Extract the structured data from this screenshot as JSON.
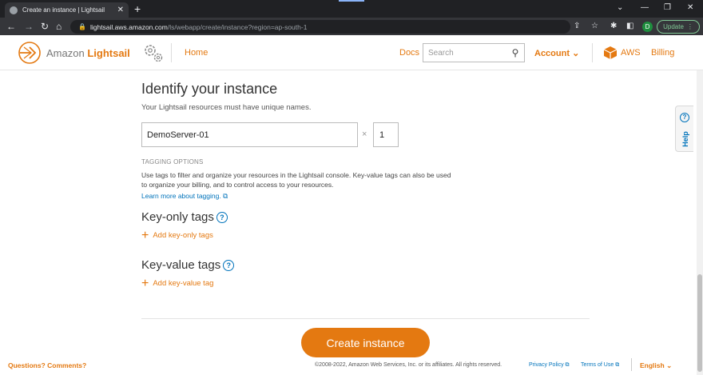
{
  "browser": {
    "tab_title": "Create an instance | Lightsail",
    "tab_close": "✕",
    "new_tab": "+",
    "url_host": "lightsail.aws.amazon.com",
    "url_path": "/ls/webapp/create/instance?region=ap-south-1",
    "profile_initial": "D",
    "update_label": "Update"
  },
  "header": {
    "brand_prefix": "Amazon",
    "brand_name": "Lightsail",
    "home": "Home",
    "docs": "Docs",
    "search_placeholder": "Search",
    "account": "Account",
    "aws": "AWS",
    "billing": "Billing",
    "accent_color": "#e47911"
  },
  "main": {
    "title": "Identify your instance",
    "subtitle": "Your Lightsail resources must have unique names.",
    "instance_name": "DemoServer-01",
    "multiplier": "×",
    "instance_count": "1",
    "tagging_heading": "TAGGING OPTIONS",
    "tagging_desc": "Use tags to filter and organize your resources in the Lightsail console. Key-value tags can also be used to organize your billing, and to control access to your resources.",
    "learn_more": "Learn more about tagging.",
    "key_only_title": "Key-only tags",
    "add_key_only": "Add key-only tags",
    "key_value_title": "Key-value tags",
    "add_key_value": "Add key-value tag",
    "create_button": "Create instance"
  },
  "help_tab": "Help",
  "footer": {
    "questions": "Questions? Comments?",
    "copyright": "©2008-2022, Amazon Web Services, Inc. or its affiliates. All rights reserved.",
    "privacy": "Privacy Policy",
    "terms": "Terms of Use",
    "language": "English"
  }
}
